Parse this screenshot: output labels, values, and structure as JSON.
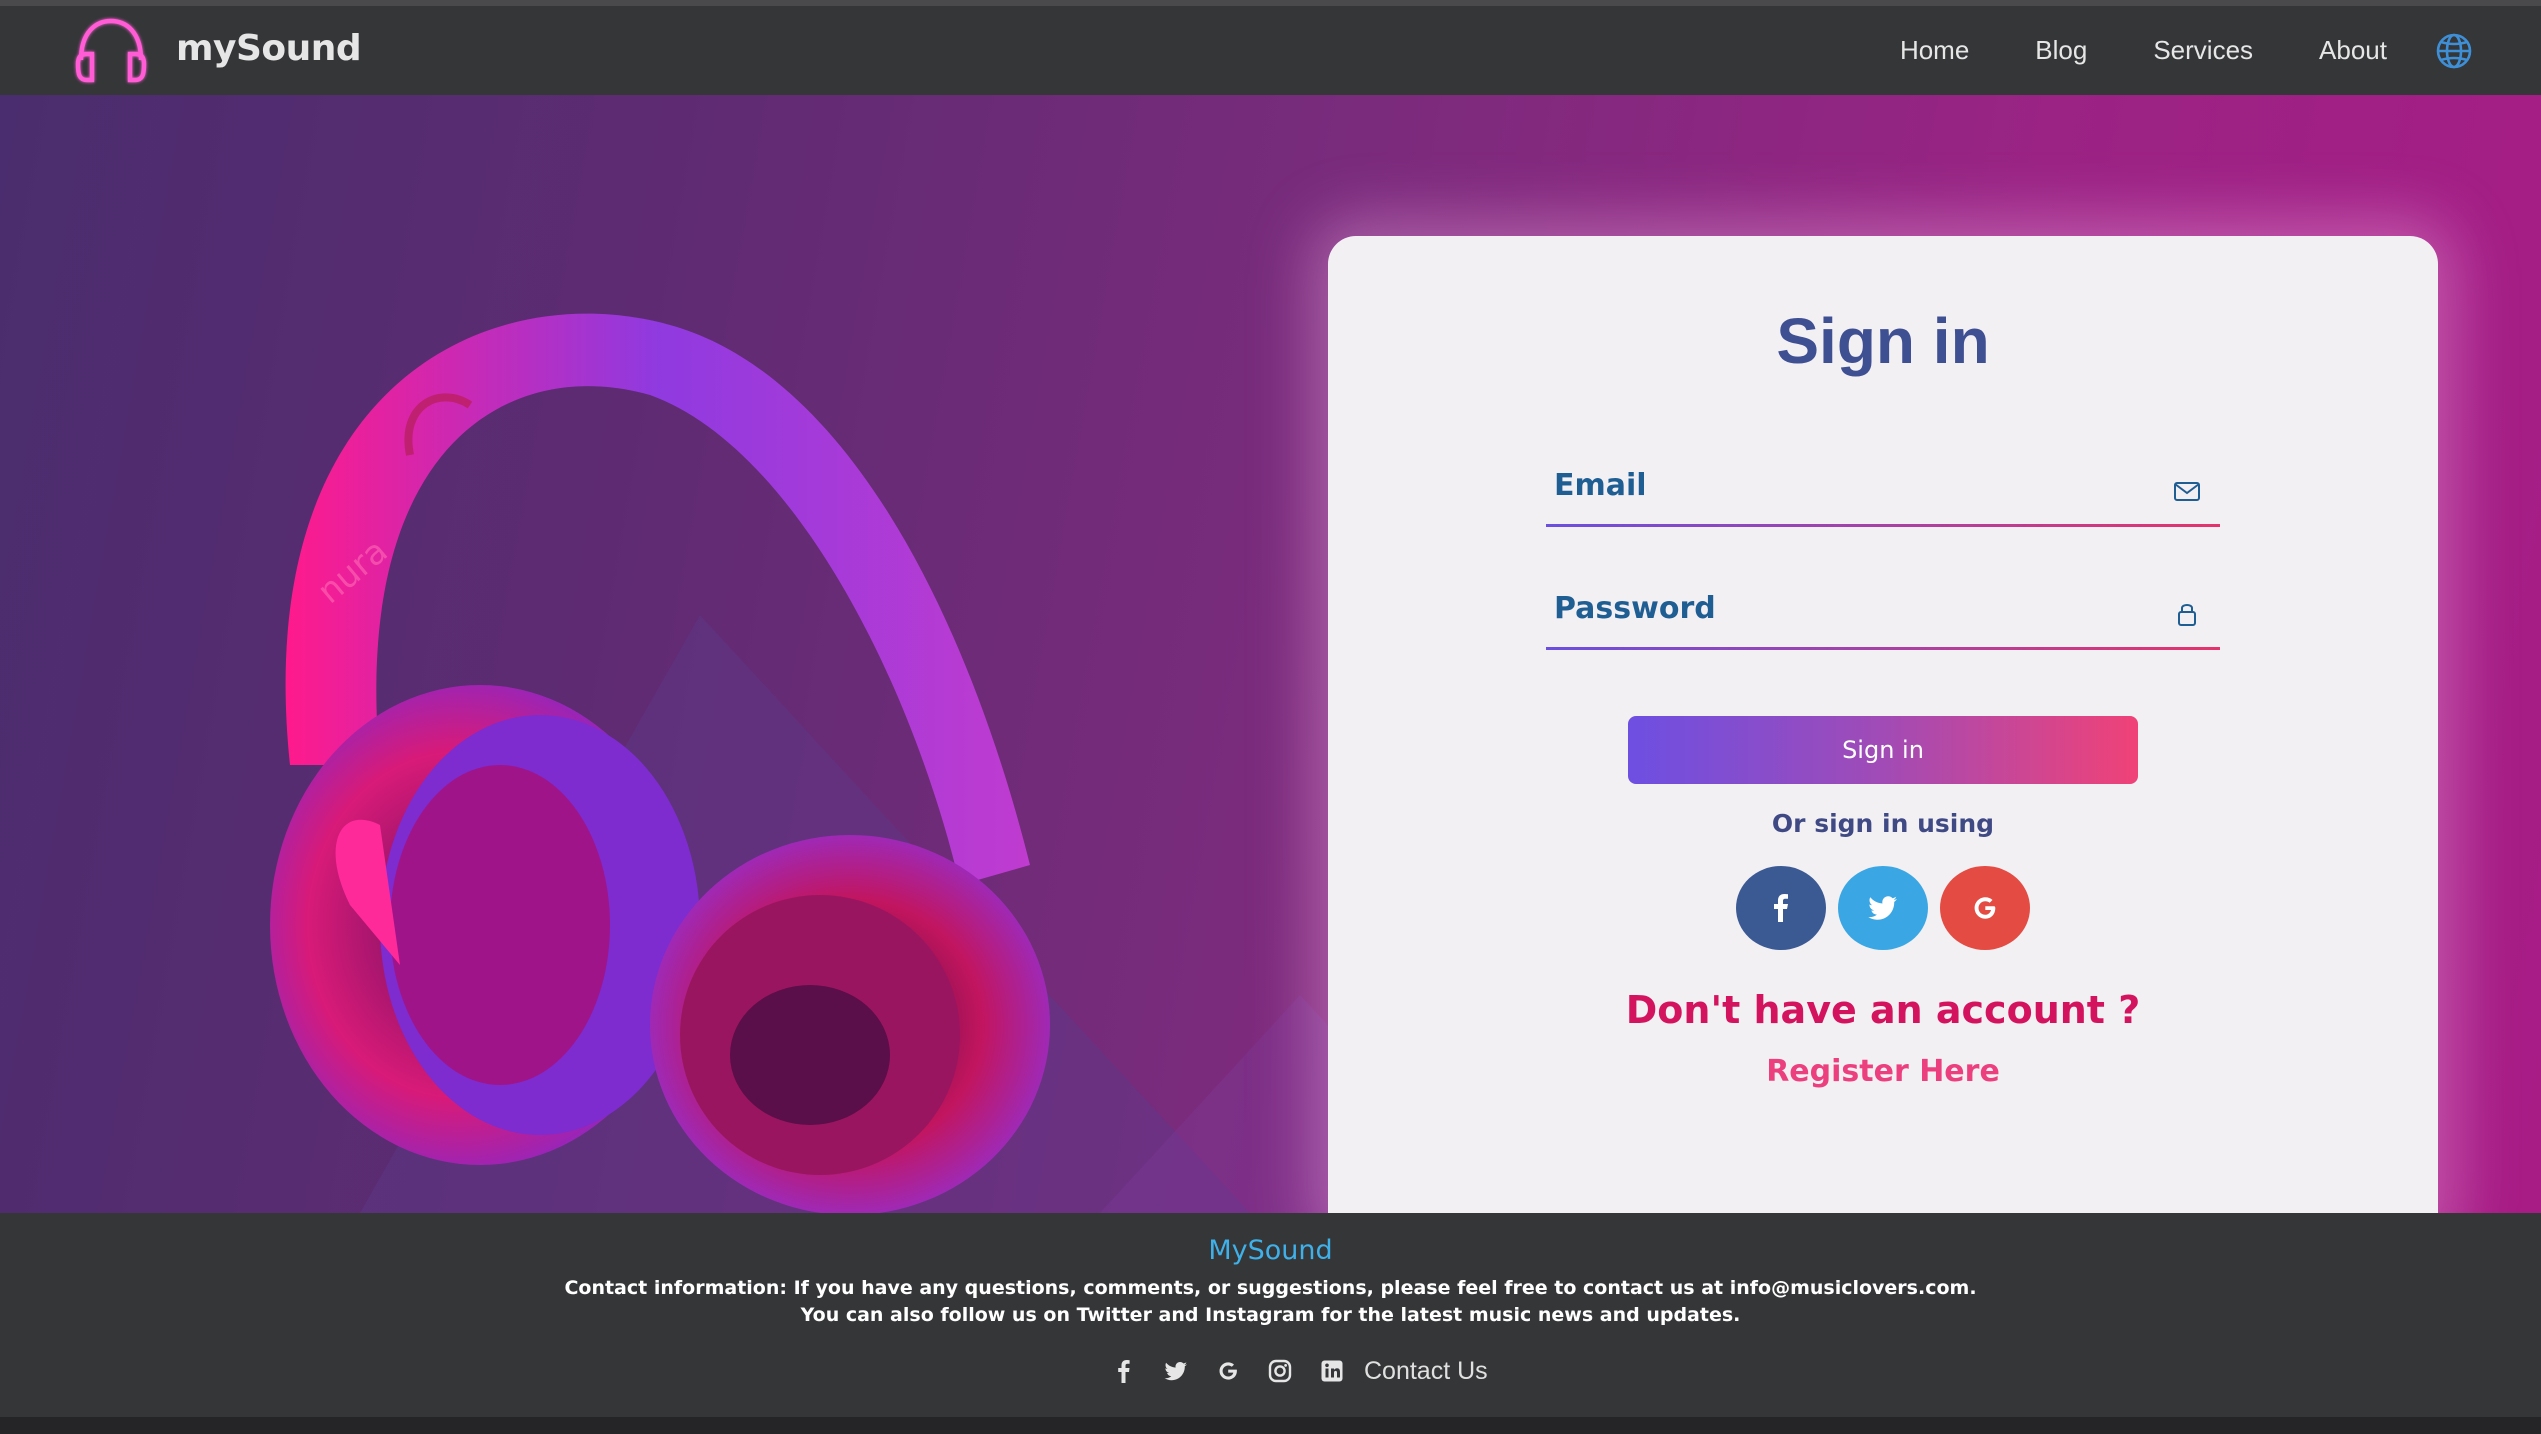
{
  "header": {
    "brand": "mySound",
    "logo_icon": "headphones-icon",
    "nav": [
      {
        "label": "Home"
      },
      {
        "label": "Blog"
      },
      {
        "label": "Services"
      },
      {
        "label": "About"
      }
    ],
    "language_icon": "globe-icon"
  },
  "signin": {
    "title": "Sign in",
    "email_label": "Email",
    "email_icon": "envelope-icon",
    "password_label": "Password",
    "password_icon": "lock-icon",
    "button_label": "Sign in",
    "alt_text": "Or sign in using",
    "socials": [
      {
        "name": "facebook",
        "color": "#3b5a94"
      },
      {
        "name": "twitter",
        "color": "#3aa7e4"
      },
      {
        "name": "google",
        "color": "#e34b43"
      }
    ],
    "no_account_text": "Don't have an account ?",
    "register_label": "Register Here"
  },
  "footer": {
    "brand": "MySound",
    "line1": "Contact information: If you have any questions, comments, or suggestions, please feel free to contact us at info@musiclovers.com.",
    "line2": "You can also follow us on Twitter and Instagram for the latest music news and updates.",
    "contact_label": "Contact Us"
  },
  "colors": {
    "accent_pink": "#e5336b",
    "accent_purple": "#6a4fe0",
    "title_blue": "#3e4f92"
  }
}
